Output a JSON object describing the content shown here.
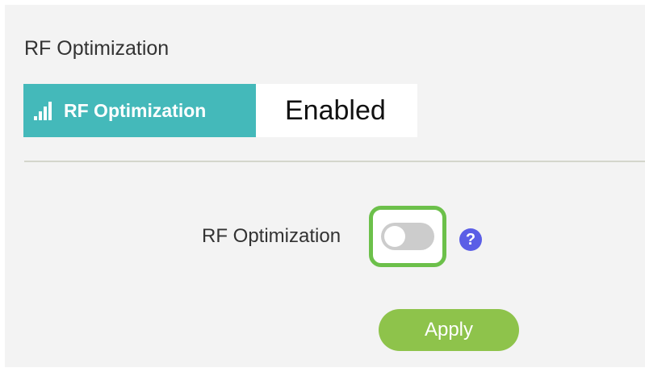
{
  "section": {
    "title": "RF Optimization"
  },
  "status_badge": {
    "label": "RF Optimization",
    "value": "Enabled",
    "icon": "signal-bars-icon",
    "accent_color": "#44b9ba"
  },
  "form": {
    "rf_optimization_label": "RF Optimization",
    "toggle_state": "off",
    "toggle_focus_color": "#6cc04a",
    "help_icon": "help-circle-icon",
    "help_glyph": "?",
    "apply_label": "Apply",
    "apply_color": "#8ec34b"
  }
}
